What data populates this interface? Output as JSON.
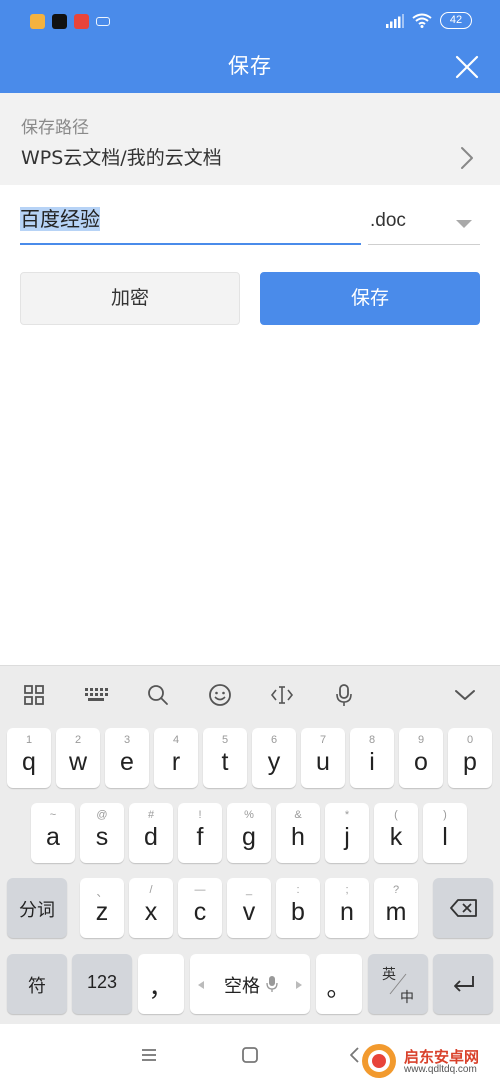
{
  "status": {
    "battery": "42",
    "apps": [
      "video-app-icon",
      "tiktok-icon",
      "health-app-icon",
      "keyboard-app-icon"
    ]
  },
  "header": {
    "title": "保存"
  },
  "save_path": {
    "label": "保存路径",
    "value": "WPS云文档/我的云文档"
  },
  "file": {
    "name": "百度经验",
    "extension": ".doc"
  },
  "actions": {
    "encrypt_label": "加密",
    "save_label": "保存"
  },
  "keyboard": {
    "row1": [
      {
        "hint": "1",
        "key": "q"
      },
      {
        "hint": "2",
        "key": "w"
      },
      {
        "hint": "3",
        "key": "e"
      },
      {
        "hint": "4",
        "key": "r"
      },
      {
        "hint": "5",
        "key": "t"
      },
      {
        "hint": "6",
        "key": "y"
      },
      {
        "hint": "7",
        "key": "u"
      },
      {
        "hint": "8",
        "key": "i"
      },
      {
        "hint": "9",
        "key": "o"
      },
      {
        "hint": "0",
        "key": "p"
      }
    ],
    "row2": [
      {
        "hint": "~",
        "key": "a"
      },
      {
        "hint": "@",
        "key": "s"
      },
      {
        "hint": "#",
        "key": "d"
      },
      {
        "hint": "!",
        "key": "f"
      },
      {
        "hint": "%",
        "key": "g"
      },
      {
        "hint": "&",
        "key": "h"
      },
      {
        "hint": "*",
        "key": "j"
      },
      {
        "hint": "(",
        "key": "k"
      },
      {
        "hint": ")",
        "key": "l"
      }
    ],
    "row3": [
      {
        "hint": "、",
        "key": "z"
      },
      {
        "hint": "/",
        "key": "x"
      },
      {
        "hint": "—",
        "key": "c"
      },
      {
        "hint": "_",
        "key": "v"
      },
      {
        "hint": ":",
        "key": "b"
      },
      {
        "hint": ";",
        "key": "n"
      },
      {
        "hint": "?",
        "key": "m"
      }
    ],
    "segment_label": "分词",
    "symbol_label": "符",
    "numbers_label": "123",
    "comma": "，",
    "space_label": "空格",
    "period": "。",
    "lang_top": "英",
    "lang_bottom": "中"
  },
  "colors": {
    "accent": "#4a8bea",
    "path_background": "#f2f2f2",
    "keyboard_background": "#ececec"
  },
  "watermark": {
    "name": "启东安卓网",
    "url": "www.qdltdq.com"
  }
}
